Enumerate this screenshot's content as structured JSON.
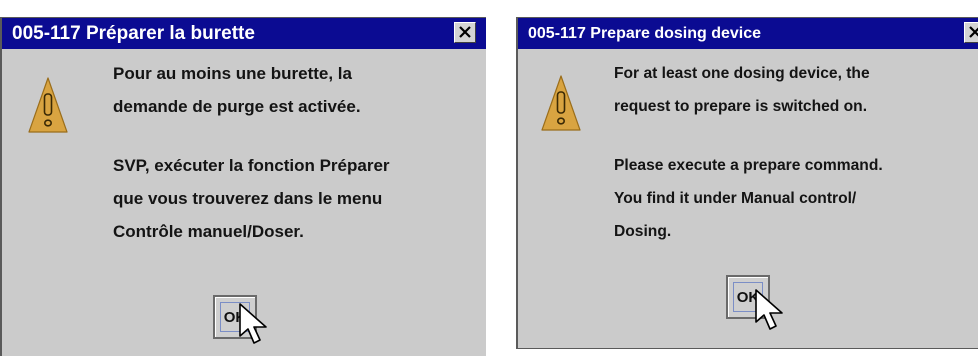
{
  "dialogs": {
    "french": {
      "title": "005-117 Préparer la burette",
      "message_lines_1": [
        "Pour au moins une burette, la",
        "demande de purge est activée."
      ],
      "message_lines_2": [
        "SVP, exécuter la fonction Préparer",
        "que vous trouverez dans le menu",
        "Contrôle manuel/Doser."
      ],
      "ok_label": "OK",
      "icon": "warning-icon",
      "close_icon": "close-icon"
    },
    "english": {
      "title": "005-117 Prepare dosing device",
      "message_lines_1": [
        "For at least one dosing device, the",
        "request to prepare is switched on."
      ],
      "message_lines_2": [
        "Please execute a prepare command.",
        "You find it under Manual control/",
        "Dosing."
      ],
      "ok_label": "OK",
      "icon": "warning-icon",
      "close_icon": "close-icon"
    }
  },
  "colors": {
    "titlebar": "#0b0b92",
    "dialog_bg": "#cbcbcb",
    "warning_fill": "#d9a441"
  }
}
